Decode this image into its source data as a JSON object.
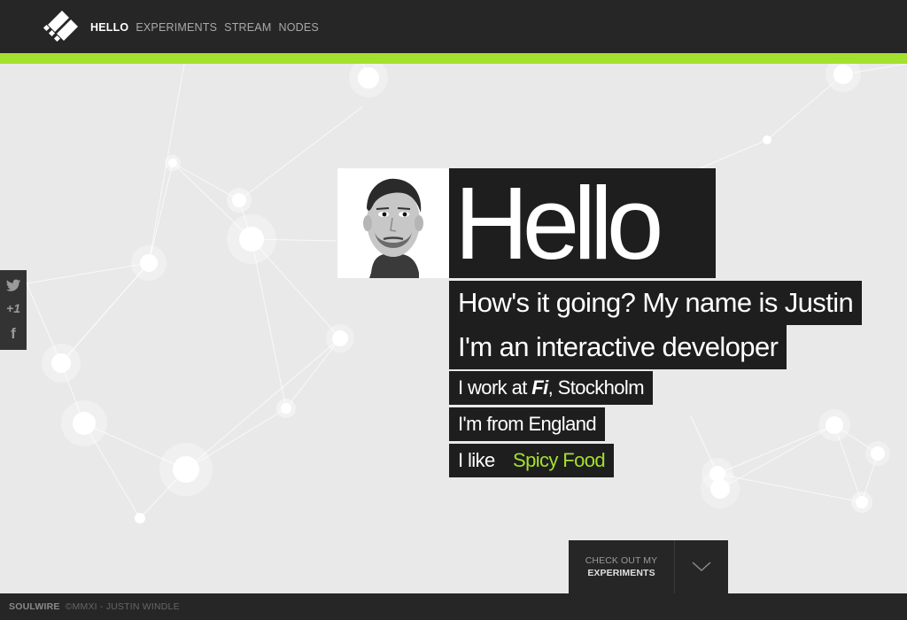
{
  "nav": {
    "logo_icon": "soulwire-logo-icon",
    "items": [
      {
        "label": "HELLO",
        "active": true
      },
      {
        "label": "EXPERIMENTS",
        "active": false
      },
      {
        "label": "STREAM",
        "active": false
      },
      {
        "label": "NODES",
        "active": false
      }
    ]
  },
  "share": {
    "twitter_icon": "twitter-icon",
    "gplus_label": "+1",
    "facebook_label": "f"
  },
  "hero": {
    "greeting": "Hello",
    "intro": "How's it going? My name is Justin",
    "role": "I'm an interactive developer",
    "work_prefix": "I work at ",
    "work_company": "Fi",
    "work_suffix": ", Stockholm",
    "origin": "I'm from England",
    "likes_prefix": "I like",
    "likes_value": "Spicy Food"
  },
  "cta": {
    "line1": "CHECK OUT MY",
    "line2": "EXPERIMENTS",
    "icon": "chevron-down-icon"
  },
  "footer": {
    "brand": "SOULWIRE",
    "copyright": "©MMXI - JUSTIN WINDLE"
  },
  "colors": {
    "accent": "#a4e02e",
    "dark": "#262626",
    "panel": "#1e1e1e",
    "background": "#e9e9e9"
  }
}
